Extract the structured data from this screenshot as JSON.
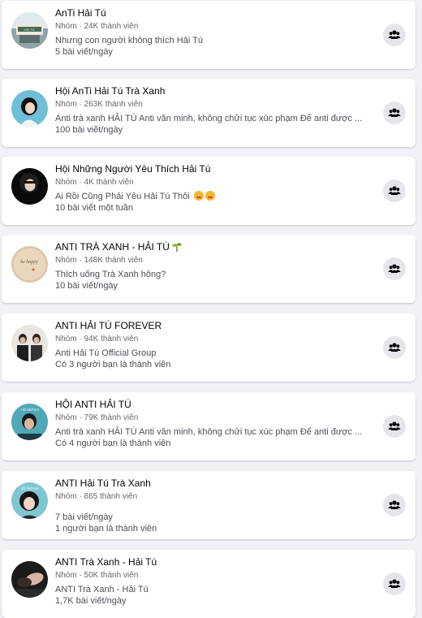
{
  "groups": [
    {
      "name": "AnTi Hải Tú",
      "meta": "Nhóm · 24K thành viên",
      "line1": "Nhưng con người không thích Hải Tú",
      "line2": "5 bài viết/ngày"
    },
    {
      "name": "Hội AnTi Hải Tú Trà Xanh",
      "meta": "Nhóm · 263K thành viên",
      "line1": "Anti trà xanh HẢI TÚ Anti văn minh, không chửi tục xúc phạm Để anti được ...",
      "line2": "100 bài viết/ngày"
    },
    {
      "name": "Hội Những Người Yêu Thích Hải Tú",
      "meta": "Nhóm · 4K thành viên",
      "line1": "Ai Rồi Cũng Phải Yêu Hải Tú Thôi",
      "line2": "10 bài viết một tuần"
    },
    {
      "name": "ANTI TRÀ XANH - HẢI TÚ",
      "meta": "Nhóm · 148K thành viên",
      "line1": "Thích uống Trà Xanh hông?",
      "line2": "10 bài viết/ngày"
    },
    {
      "name": "ANTI HẢI TÚ FOREVER",
      "meta": "Nhóm · 94K thành viên",
      "line1": "Anti Hải Tú Official Group",
      "line2": "Có 3 người bạn là thành viên"
    },
    {
      "name": "HỘI ANTI HẢI TÚ",
      "meta": "Nhóm · 79K thành viên",
      "line1": "Anti trà xanh HẢI TÚ Anti văn minh, không chửi tục xúc phạm Để anti được ...",
      "line2": "Có 4 người bạn là thành viên"
    },
    {
      "name": "ANTI Hải Tú Trà Xanh",
      "meta": "Nhóm · 865 thành viên",
      "line1": "7 bài viết/ngày",
      "line2": "1 người bạn là thành viên"
    },
    {
      "name": "ANTI Trà Xanh - Hải Tú",
      "meta": "Nhóm · 50K thành viên",
      "line1": "ANTI Trà Xanh - Hải Tú",
      "line2": "1,7K bài viết/ngày"
    }
  ],
  "icons": {
    "join_button": "group-people-icon",
    "emoji_row3": "grinning-emoji-icon",
    "emoji_row4": "sprout-icon"
  },
  "colors": {
    "background": "#f0f2f5",
    "card": "#ffffff",
    "button_bg": "#e4e6eb",
    "secondary_text": "#65676b"
  },
  "avatar_labels": {
    "group1_sign": "HẢI TÚ",
    "group4_text": "be happy",
    "group6_text": "rất nhớ em",
    "group7_text": "đã nhớ em"
  }
}
